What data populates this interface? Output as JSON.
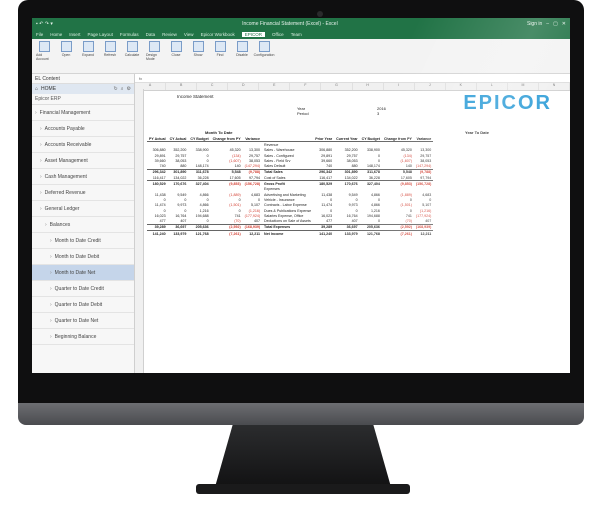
{
  "app": {
    "title": "Income Financial Statement (Excel) - Excel",
    "window_controls": [
      "–",
      "▢",
      "✕"
    ],
    "signin": "Sign in"
  },
  "menu": [
    "File",
    "Home",
    "Insert",
    "Page Layout",
    "Formulas",
    "Data",
    "Review",
    "View",
    "Epicor Workbook",
    "EPICOR",
    "Office",
    "Team"
  ],
  "menu_active": "EPICOR",
  "ribbon": [
    "Add Account",
    "Open",
    "Expand",
    "Refresh",
    "Calculate",
    "Design Mode",
    "Close",
    "Show",
    "Find",
    "Disable",
    "Configuration"
  ],
  "sidebar": {
    "title": "EL Content",
    "home": "HOME",
    "company": "Epicor ERP",
    "items": [
      "Financial Management",
      "Accounts Payable",
      "Accounts Receivable",
      "Asset Management",
      "Cash Management",
      "Deferred Revenue",
      "General Ledger",
      "Balances",
      "Month to Date Credit",
      "Month to Date Debit",
      "Month to Date Net",
      "Quarter to Date Credit",
      "Quarter to Date Debit",
      "Quarter to Date Net",
      "Beginning Balance"
    ],
    "indents": [
      0,
      1,
      1,
      1,
      1,
      1,
      1,
      2,
      3,
      3,
      3,
      3,
      3,
      3,
      3
    ],
    "selected_index": 10
  },
  "sheet": {
    "column_letters": [
      "A",
      "B",
      "C",
      "D",
      "E",
      "F",
      "G",
      "H",
      "I",
      "J",
      "K",
      "L",
      "M",
      "N"
    ],
    "logo": "EPICOR",
    "report_title": "Income Statement",
    "year_label": "Year",
    "year_value": "2016",
    "period_label": "Period",
    "period_value": "3",
    "mtd_header": "Month To Date",
    "ytd_header": "Year To Date",
    "left_columns": [
      "PY Actual",
      "CY Actual",
      "CY Budget",
      "Change from PY",
      "Variance"
    ],
    "right_columns": [
      "Prior Year",
      "Current Year",
      "CY Budget",
      "Change from PY",
      "Variance"
    ],
    "rows": [
      {
        "label": "Revenue",
        "type": "section"
      },
      {
        "label": "Sales - Warehouse",
        "l": [
          "306,880",
          "352,200",
          "338,900",
          "45,320",
          "13,300"
        ],
        "r": [
          "306,880",
          "352,200",
          "338,900",
          "45,320",
          "13,300"
        ]
      },
      {
        "label": "Sales - Configured",
        "l": [
          "29,891",
          "29,757",
          "0",
          "(134)",
          "29,757"
        ],
        "r": [
          "29,891",
          "29,757",
          "0",
          "(134)",
          "29,757"
        ]
      },
      {
        "label": "Sales - Field Srv",
        "l": [
          "39,660",
          "38,053",
          "0",
          "(1,607)",
          "38,053"
        ],
        "r": [
          "39,660",
          "38,053",
          "0",
          "(1,607)",
          "38,053"
        ]
      },
      {
        "label": "Sales Default",
        "l": "740 | 880 | 148,174 | 140 | (147,294)",
        "r": "740 | 880 | 148,174 | 140 | (147,294)"
      },
      {
        "label": "Total Sales",
        "type": "total",
        "l": [
          "296,342",
          "301,890",
          "311,678",
          "5,548",
          "(9,788)"
        ],
        "r": [
          "296,342",
          "301,890",
          "311,678",
          "5,548",
          "(9,788)"
        ]
      },
      {
        "label": "Cost of Sales",
        "l": [
          "116,417",
          "134,022",
          "36,228",
          "17,605",
          "97,794"
        ],
        "r": [
          "116,417",
          "134,022",
          "36,228",
          "17,605",
          "97,794"
        ]
      },
      {
        "label": "Gross Profit",
        "type": "total",
        "l": [
          "180,529",
          "170,676",
          "327,404",
          "(9,853)",
          "(156,728)"
        ],
        "r": [
          "180,529",
          "170,676",
          "327,404",
          "(9,853)",
          "(156,728)"
        ]
      },
      {
        "label": "Expenses",
        "type": "section"
      },
      {
        "label": "Advertising and Marketing",
        "l": [
          "11,438",
          "9,549",
          "4,866",
          "(1,889)",
          "4,683"
        ],
        "r": [
          "11,438",
          "9,549",
          "4,866",
          "(1,889)",
          "4,683"
        ]
      },
      {
        "label": "Vehicle - Insurance",
        "l": [
          "0",
          "0",
          "0",
          "0",
          "0"
        ],
        "r": [
          "0",
          "0",
          "0",
          "0",
          "0"
        ]
      },
      {
        "label": "Contracts - Labor Expense",
        "l": [
          "11,474",
          "9,973",
          "4,866",
          "(1,501)",
          "5,107"
        ],
        "r": [
          "11,474",
          "9,973",
          "4,866",
          "(1,501)",
          "5,107"
        ]
      },
      {
        "label": "Dues & Publications Expense",
        "l": [
          "0",
          "0",
          "1,216",
          "0",
          "(1,216)"
        ],
        "r": [
          "0",
          "0",
          "1,216",
          "0",
          "(1,216)"
        ]
      },
      {
        "label": "Salaries Expense, Office",
        "l": [
          "16,023",
          "16,764",
          "194,688",
          "741",
          "(177,924)"
        ],
        "r": [
          "16,023",
          "16,764",
          "194,688",
          "741",
          "(177,924)"
        ]
      },
      {
        "label": "Deductions on Sale of Assets",
        "l": [
          "477",
          "407",
          "0",
          "(70)",
          "407"
        ],
        "r": [
          "477",
          "407",
          "0",
          "(70)",
          "407"
        ]
      },
      {
        "label": "Total Expenses",
        "type": "total",
        "l": [
          "39,289",
          "36,697",
          "205,636",
          "(2,592)",
          "(168,939)"
        ],
        "r": [
          "39,289",
          "36,697",
          "205,636",
          "(2,592)",
          "(168,939)"
        ]
      },
      {
        "label": "Net Income",
        "type": "grand",
        "l": [
          "141,240",
          "133,979",
          "121,768",
          "(7,261)",
          "12,211"
        ],
        "r": [
          "141,240",
          "133,979",
          "121,768",
          "(7,261)",
          "12,211"
        ]
      }
    ]
  }
}
